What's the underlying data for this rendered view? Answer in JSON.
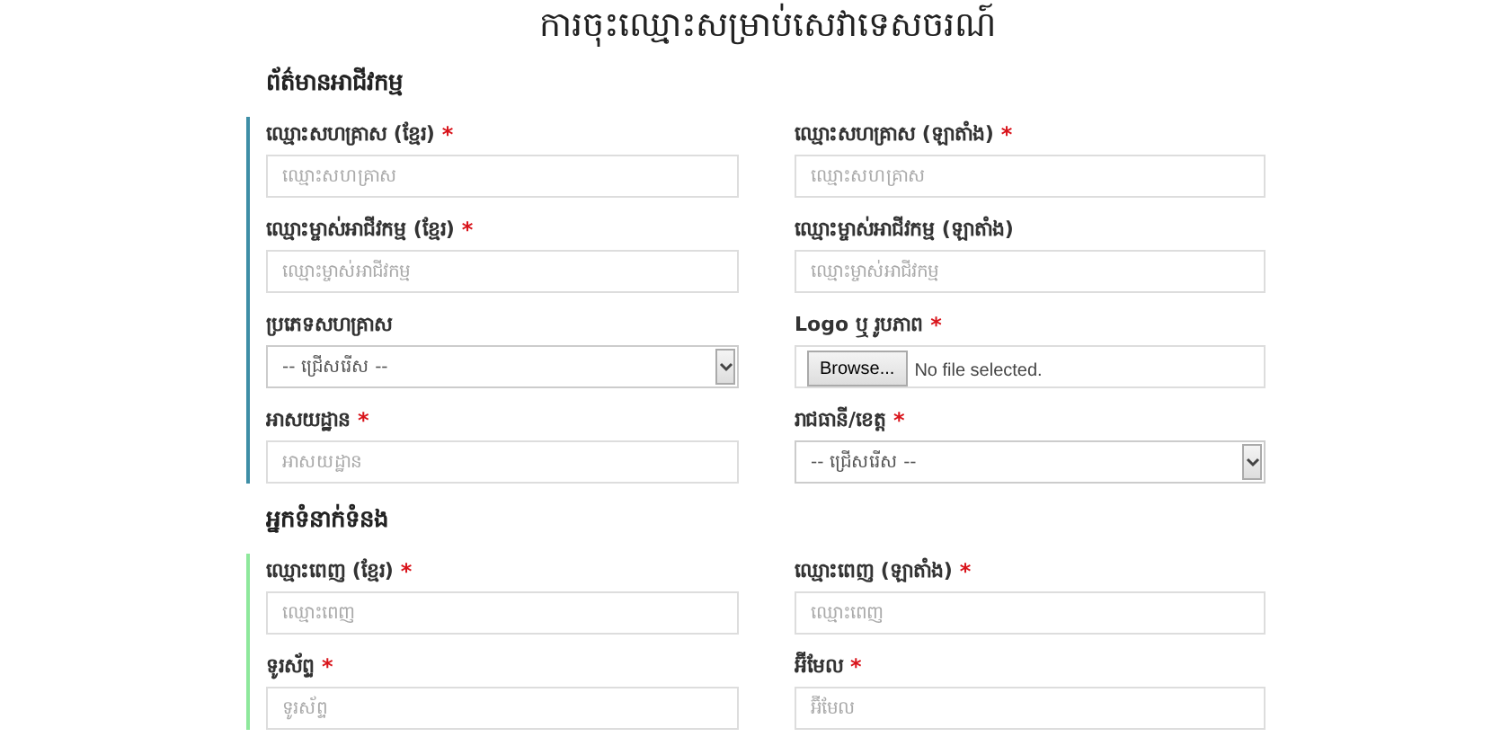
{
  "title": "ការចុះឈ្មោះសម្រាប់សេវាទេសចរណ៍",
  "sections": [
    {
      "title": "ព័ត៌មានអាជីវកម្ម",
      "color": "#3e8ea6",
      "fields": [
        {
          "kind": "text",
          "label": "ឈ្មោះសហគ្រាស (ខ្មែរ)",
          "required_mark": "*",
          "placeholder": "ឈ្មោះសហគ្រាស"
        },
        {
          "kind": "text",
          "label": "ឈ្មោះសហគ្រាស (ឡាតាំង)",
          "required_mark": "*",
          "placeholder": "ឈ្មោះសហគ្រាស"
        },
        {
          "kind": "text",
          "label": "ឈ្មោះម្ចាស់អាជីវកម្ម (ខ្មែរ)",
          "required_mark": "*",
          "placeholder": "ឈ្មោះម្ចាស់អាជីវកម្ម"
        },
        {
          "kind": "text",
          "label": "ឈ្មោះម្ចាស់អាជីវកម្ម (ឡាតាំង)",
          "placeholder": "ឈ្មោះម្ចាស់អាជីវកម្ម"
        },
        {
          "kind": "select",
          "label": "ប្រភេទសហគ្រាស",
          "value": "-- ជ្រើសរើស --"
        },
        {
          "kind": "file",
          "label": "Logo ឬ រូបភាព",
          "required_mark": "*",
          "button": "Browse...",
          "status": "No file selected."
        },
        {
          "kind": "text",
          "label": "អាសយដ្ឋាន",
          "required_mark": "*",
          "placeholder": "អាសយដ្ឋាន"
        },
        {
          "kind": "select",
          "label": "រាជធានី/ខេត្ត",
          "required_mark": "*",
          "value": "-- ជ្រើសរើស --"
        }
      ]
    },
    {
      "title": "អ្នកទំនាក់ទំនង",
      "color": "#8ee89c",
      "fields": [
        {
          "kind": "text",
          "label": "ឈ្មោះពេញ (ខ្មែរ)",
          "required_mark": "*",
          "placeholder": "ឈ្មោះពេញ"
        },
        {
          "kind": "text",
          "label": "ឈ្មោះពេញ (ឡាតាំង)",
          "required_mark": "*",
          "placeholder": "ឈ្មោះពេញ"
        },
        {
          "kind": "text",
          "label": "ទូរស័ព្ទ",
          "required_mark": "*",
          "placeholder": "ទូរស័ព្ទ"
        },
        {
          "kind": "text",
          "label": "អ៊ីមែល",
          "required_mark": "*",
          "placeholder": "អ៊ីមែល"
        }
      ]
    }
  ]
}
